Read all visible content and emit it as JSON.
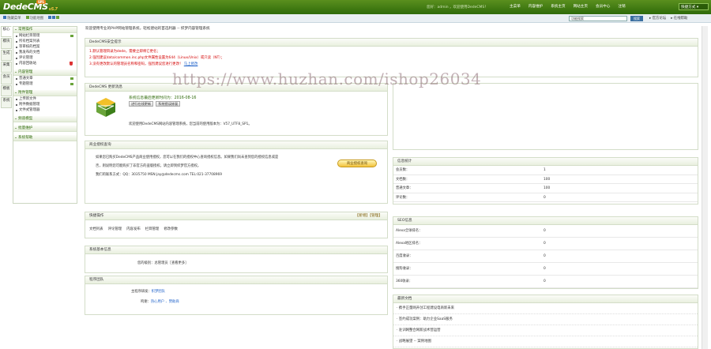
{
  "app": {
    "logo": "DedeCMS",
    "version": "v5.7",
    "badge": "SP1"
  },
  "top": {
    "userinfo": "您好：admin ，欢迎使用DedeCMS！",
    "nav": [
      "主菜单",
      "内容维护",
      "系统主页",
      "网站主页",
      "会员中心",
      "注销"
    ],
    "quick": "快捷方式 ▾"
  },
  "sub": {
    "left": [
      "隐藏菜单",
      "功能地图"
    ],
    "search_placeholder": "功能搜索",
    "search_btn": "搜索",
    "right": [
      "官方论坛",
      "在线帮助"
    ]
  },
  "vtabs": [
    "核心",
    "模块",
    "生成",
    "采集",
    "会员",
    "模板",
    "系统"
  ],
  "menu": [
    {
      "h": "常用操作",
      "items": [
        {
          "t": "网站栏目管理",
          "ic": "plus"
        },
        {
          "t": "所有档案列表"
        },
        {
          "t": "等审核的档案"
        },
        {
          "t": "我发布的文档"
        },
        {
          "t": "评论管理"
        },
        {
          "t": "内容回收站",
          "ic": "shield"
        }
      ]
    },
    {
      "h": "内容管理",
      "items": [
        {
          "t": "普通文章",
          "ic": "plus"
        },
        {
          "t": "专题管理",
          "ic": "plus"
        }
      ]
    },
    {
      "h": "附件管理",
      "items": [
        {
          "t": "上传新文件"
        },
        {
          "t": "附件数据管理"
        },
        {
          "t": "文件式管理器"
        }
      ]
    },
    {
      "h": "频道模型",
      "items": []
    },
    {
      "h": "批量维护",
      "items": []
    },
    {
      "h": "系统帮助",
      "items": []
    }
  ],
  "welcome": "欢迎使用专业的PHP网站管理系统，轻松建站的首选利器 -- 织梦内容管理系统",
  "security": {
    "title": "DedeCMS安全提示",
    "l1": "1.默认管理目录为dede，需要立即将它更名；",
    "l2": "2.强烈建议data/common.inc.php文件属性设置为644（Linux/Unix）或只读（NT）；",
    "l3a": "3.没有更改默认的管理员名称和密码，强烈建议您进行更改！",
    "l3b": "马上修改"
  },
  "update": {
    "title": "DedeCMS 更新消息",
    "date_label": "系统信息最后更新时间为：",
    "date": "2016-08-16",
    "btn1": "进行在线更新",
    "btn2": "系统错误修复",
    "text": "欢迎使用DedeCMS网站内容管理系统，您当前的使用版本为：V57_UTF8_SP1。"
  },
  "license": {
    "title": "商业授权查询",
    "l1": "如果您已购买DedeCMS产品商业使用授权，您可以在我们的授权中心查询授权信息。如果我们尚未查到您的授权信息或是",
    "l2": "否，则说明您可能购买了非官方的盗版授权，请立即到织梦官方授权。",
    "l3": "我们的联系方式：QQ：3035750 MSN:jay@dedecms.com TEL:021-37708969",
    "btn": "商业授权查询"
  },
  "quick_ops": {
    "title": "快捷操作",
    "extra": "【新增】【管理】",
    "links": [
      "文档列表",
      "评论管理",
      "内容发布",
      "栏目管理",
      "修改参数"
    ]
  },
  "sysinfo": {
    "title": "系统基本信息",
    "label": "您的级别：",
    "value": "总管理员［查看更多］"
  },
  "team": {
    "title": "程序团队",
    "k1": "主程序研发：",
    "v1": "织梦团队",
    "k2": "鸣谢：",
    "v2": "热心用户 、赞助商"
  },
  "stats": {
    "title": "信息统计",
    "rows": [
      [
        "会员数：",
        "1"
      ],
      [
        "文档数：",
        "100"
      ],
      [
        "普通文章：",
        "100"
      ],
      [
        "评论数：",
        "0"
      ]
    ]
  },
  "seo": {
    "title": "SEO信息",
    "rows": [
      [
        "Alexa全球排名：",
        "0"
      ],
      [
        "Alexa地区排名：",
        "0"
      ],
      [
        "百度收录：",
        "0"
      ],
      [
        "搜狗收录：",
        "0"
      ],
      [
        "360收录：",
        "0"
      ]
    ]
  },
  "docs": {
    "title": "最新文档",
    "items": [
      "携手正量网开创工程建设电商新未来",
      "签约成功案例：助力企业SaaS服务",
      "驻训网整合网新战术营运营",
      "战略展望 -- 案例地图"
    ]
  },
  "watermark": "https://www.huzhan.com/ishop26034"
}
